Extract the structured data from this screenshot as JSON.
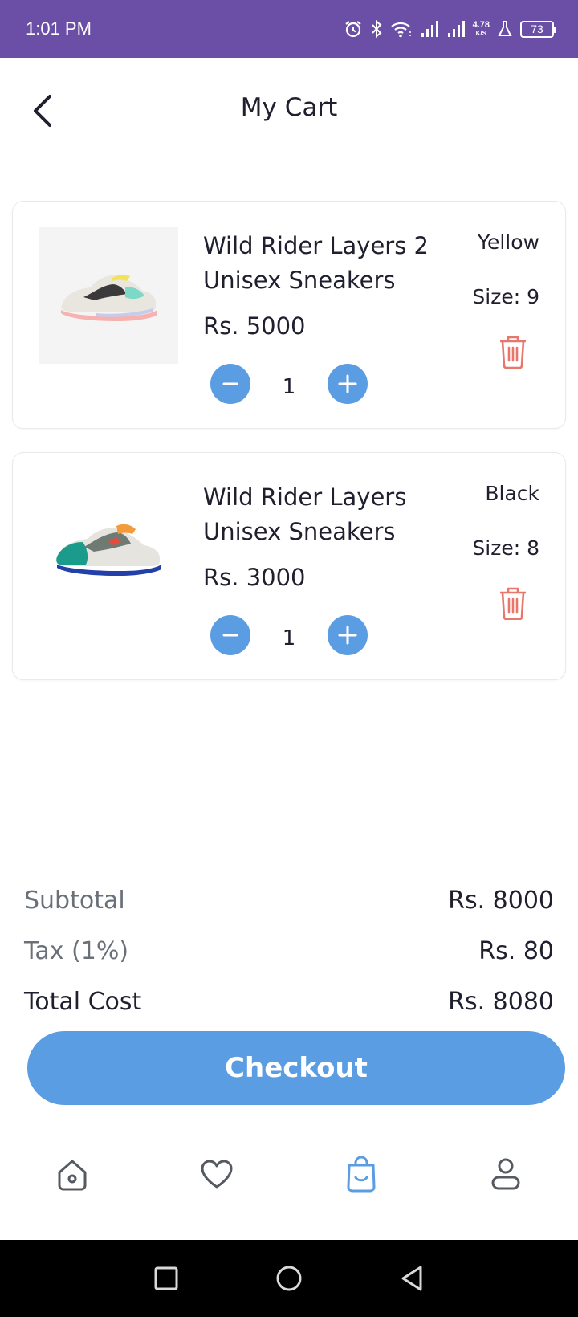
{
  "status_bar": {
    "time": "1:01 PM",
    "net_speed_value": "4.78",
    "net_speed_unit": "K/S",
    "battery": "73"
  },
  "header": {
    "title": "My Cart"
  },
  "cart": {
    "items": [
      {
        "name": "Wild Rider Layers 2 Unisex Sneakers",
        "price": "Rs. 5000",
        "color": "Yellow",
        "size": "Size: 9",
        "quantity": "1"
      },
      {
        "name": "Wild Rider Layers Unisex Sneakers",
        "price": "Rs. 3000",
        "color": "Black",
        "size": "Size: 8",
        "quantity": "1"
      }
    ]
  },
  "summary": {
    "subtotal_label": "Subtotal",
    "subtotal_value": "Rs. 8000",
    "tax_label": "Tax (1%)",
    "tax_value": "Rs. 80",
    "total_label": "Total Cost",
    "total_value": "Rs. 8080"
  },
  "checkout_label": "Checkout",
  "bottom_nav": {
    "items": [
      "home-icon",
      "heart-icon",
      "shopping-bag-icon",
      "profile-icon"
    ],
    "active": "shopping-bag-icon",
    "active_color": "#5b9de2",
    "inactive_color": "#555a61"
  },
  "colors": {
    "status_bar": "#6b4ea5",
    "accent": "#5b9de2",
    "delete": "#e8766a"
  }
}
